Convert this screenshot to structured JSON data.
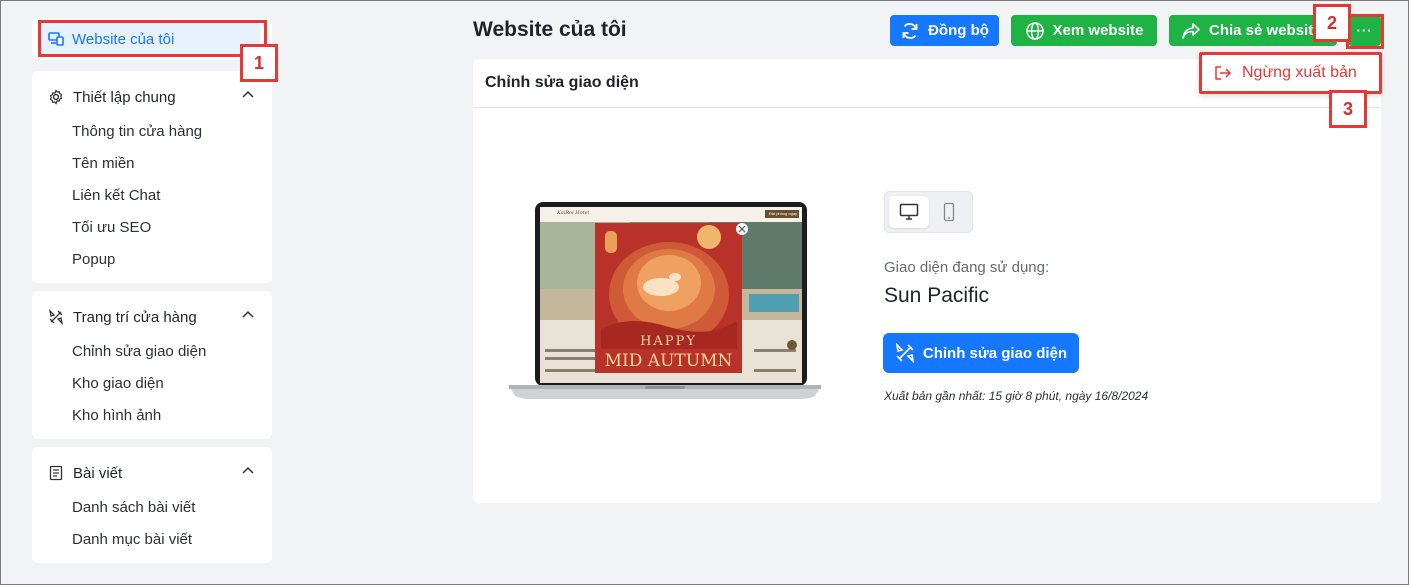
{
  "sidebar": {
    "my_website": "Website của tôi",
    "groups": [
      {
        "title": "Thiết lập chung",
        "items": [
          "Thông tin cửa hàng",
          "Tên miền",
          "Liên kết Chat",
          "Tối ưu SEO",
          "Popup"
        ]
      },
      {
        "title": "Trang trí cửa hàng",
        "items": [
          "Chỉnh sửa giao diện",
          "Kho giao diện",
          "Kho hình ảnh"
        ]
      },
      {
        "title": "Bài viết",
        "items": [
          "Danh sách bài viết",
          "Danh mục bài viết"
        ]
      }
    ]
  },
  "header": {
    "title": "Website của tôi",
    "sync_label": "Đồng bộ",
    "view_label": "Xem website",
    "share_label": "Chia sẻ website",
    "more_label": "···"
  },
  "dropdown": {
    "unpublish_label": "Ngừng xuất bản"
  },
  "card": {
    "title": "Chỉnh sửa giao diện",
    "using_label": "Giao diện đang sử dụng:",
    "theme_name": "Sun Pacific",
    "edit_button": "Chỉnh sửa giao diện",
    "published_text": "Xuất bản gần nhất: 15 giờ 8 phút, ngày 16/8/2024"
  },
  "preview": {
    "site_logo": "KaiRoi Hotel",
    "site_button": "Đặt phòng ngay",
    "popup_line1": "HAPPY",
    "popup_line2": "MID AUTUMN"
  },
  "markers": [
    "1",
    "2",
    "3"
  ],
  "colors": {
    "primary": "#1677ff",
    "success": "#1fb245",
    "danger": "#e53935",
    "popup_bg": "#c0392b"
  }
}
